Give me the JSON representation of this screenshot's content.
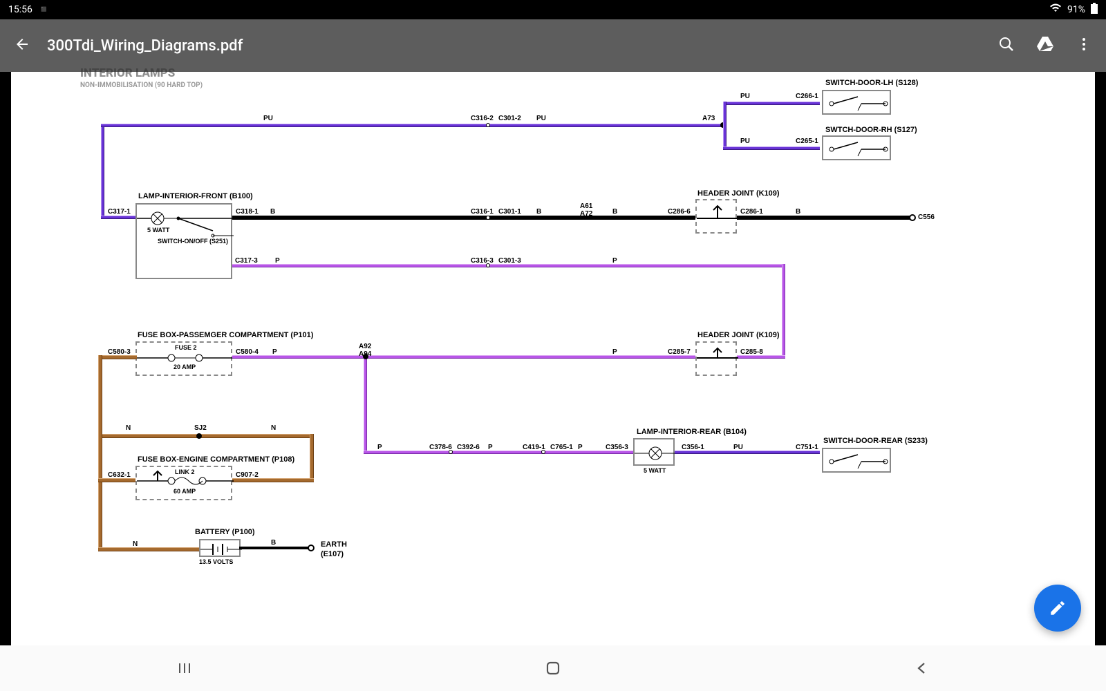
{
  "status": {
    "time": "15:56",
    "battery": "91%"
  },
  "appbar": {
    "title": "300Tdi_Wiring_Diagrams.pdf"
  },
  "page": {
    "title": "INTERIOR LAMPS",
    "subtitle": "NON-IMMOBILISATION (90 HARD TOP)"
  },
  "components": {
    "sw_door_lh": "SWITCH-DOOR-LH (S128)",
    "sw_door_rh": "SWTCH-DOOR-RH (S127)",
    "lamp_front": "LAMP-INTERIOR-FRONT (B100)",
    "sw_onoff": "SWITCH-ON/OFF (S251)",
    "watt5a": "5 WATT",
    "header_joint1": "HEADER JOINT (K109)",
    "header_joint2": "HEADER JOINT (K109)",
    "fuse_pass": "FUSE BOX-PASSEMGER COMPARTMENT (P101)",
    "fuse2": "FUSE 2",
    "amp20": "20 AMP",
    "fuse_eng": "FUSE BOX-ENGINE COMPARTMENT (P108)",
    "link2": "LINK 2",
    "amp60": "60 AMP",
    "battery": "BATTERY (P100)",
    "volts": "13.5 VOLTS",
    "earth": "EARTH",
    "earth2": "(E107)",
    "lamp_rear": "LAMP-INTERIOR-REAR (B104)",
    "watt5b": "5 WATT",
    "sw_door_rear": "SWITCH-DOOR-REAR (S233)"
  },
  "conn": {
    "c266_1": "C266-1",
    "c265_1": "C265-1",
    "c316_2": "C316-2",
    "c301_2": "C301-2",
    "a73": "A73",
    "c317_1": "C317-1",
    "c318_1": "C318-1",
    "c316_1": "C316-1",
    "c301_1": "C301-1",
    "a61": "A61",
    "a72": "A72",
    "c286_6": "C286-6",
    "c286_1": "C286-1",
    "c556": "C556",
    "c317_3": "C317-3",
    "c316_3": "C316-3",
    "c301_3": "C301-3",
    "c580_3": "C580-3",
    "c580_4": "C580-4",
    "a92": "A92",
    "a94": "A94",
    "c285_7": "C285-7",
    "c285_8": "C285-8",
    "sj2": "SJ2",
    "c632_1": "C632-1",
    "c907_2": "C907-2",
    "c378_6": "C378-6",
    "c392_6": "C392-6",
    "c419_1": "C419-1",
    "c765_1": "C765-1",
    "c356_3": "C356-3",
    "c356_1": "C356-1",
    "c751_1": "C751-1"
  },
  "colors": {
    "pu": "PU",
    "b": "B",
    "p": "P",
    "n": "N"
  }
}
